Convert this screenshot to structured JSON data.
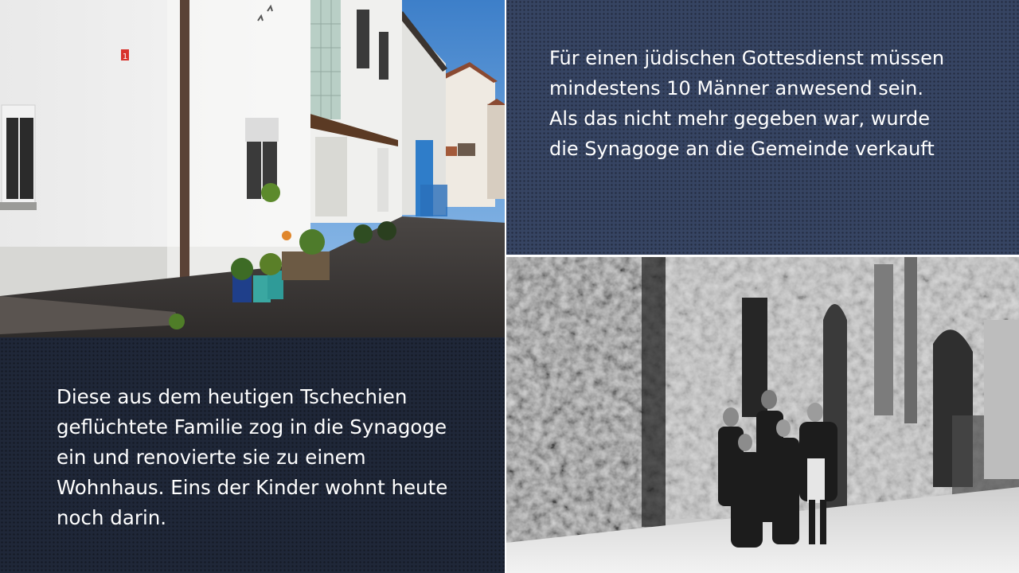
{
  "slide": {
    "top_right_text": "Für einen jüdischen Gottesdienst müssen\nmindestens 10 Männer anwesend sein.\nAls das nicht mehr gegeben war, wurde\ndie Synagoge an die Gemeinde verkauft",
    "bottom_left_text": "Diese aus dem heutigen Tschechien\ngeflüchtete Familie zog in die Synagoge\nein und renovierte sie zu einem\nWohnhaus. Eins der Kinder wohnt heute\nnoch darin.",
    "house_number_sign": "1"
  },
  "colors": {
    "panel_top": "#364462",
    "panel_bottom": "#1f2738",
    "text": "#ffffff"
  }
}
